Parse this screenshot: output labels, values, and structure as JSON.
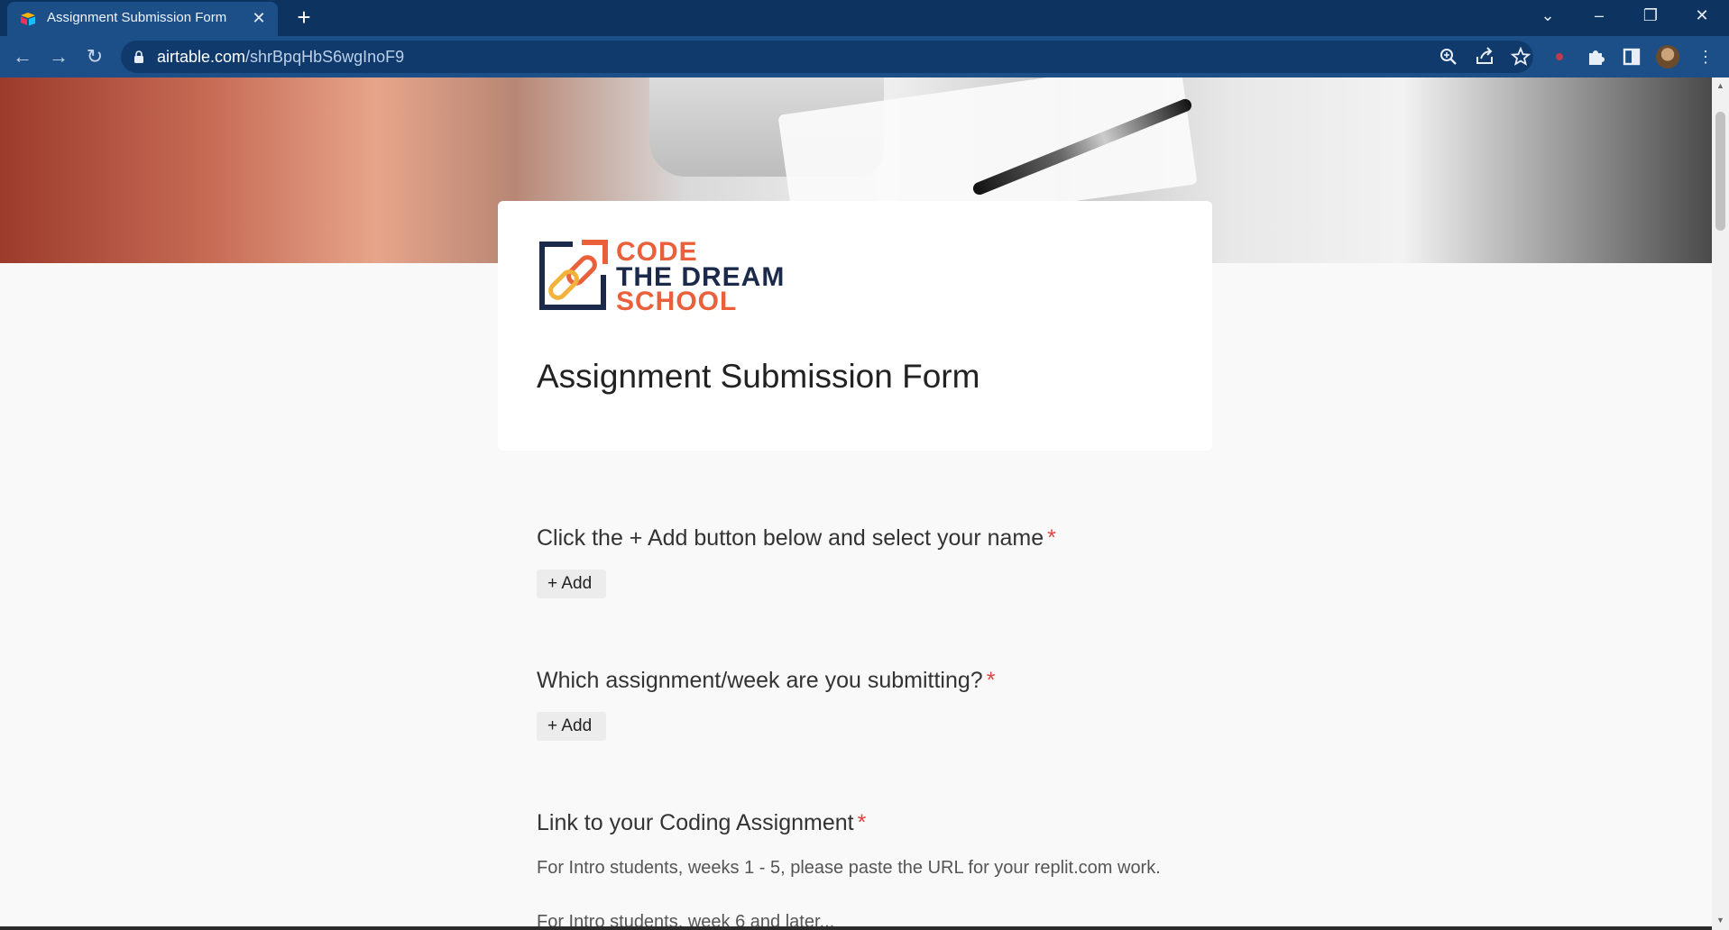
{
  "browser": {
    "tab_title": "Assignment Submission Form",
    "tab_close": "✕",
    "new_tab": "+",
    "url_host": "airtable.com",
    "url_path": "/shrBpqHbS6wgInoF9",
    "window_controls": {
      "dropdown": "⌄",
      "minimize": "–",
      "restore": "❐",
      "close": "✕"
    },
    "nav": {
      "back": "←",
      "forward": "→",
      "reload": "↻"
    }
  },
  "form": {
    "logo": {
      "line1": "CODE",
      "line2": "THE DREAM",
      "line3": "SCHOOL"
    },
    "title": "Assignment Submission Form",
    "fields": [
      {
        "label": "Click the + Add button below and select your name",
        "required_mark": "*",
        "button": "+ Add"
      },
      {
        "label": "Which assignment/week are you submitting?",
        "required_mark": "*",
        "button": "+ Add"
      },
      {
        "label": "Link to your Coding Assignment",
        "required_mark": "*",
        "help_1": "For Intro students, weeks 1 - 5, please paste the URL for your replit.com work.",
        "help_2": "For Intro students, week 6 and later..."
      }
    ]
  },
  "colors": {
    "titlebar": "#0d3461",
    "toolbar": "#1c4f88",
    "accent": "#e9603a",
    "navy": "#1b2a4a",
    "required": "#e0453f"
  }
}
